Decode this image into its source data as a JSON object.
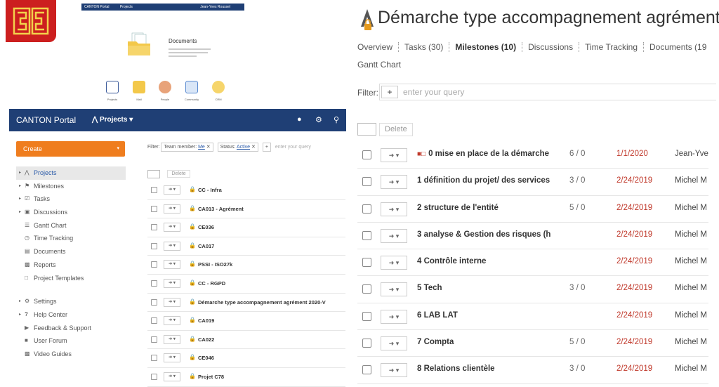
{
  "logo": {
    "name": "canton-logo"
  },
  "mini_portal": {
    "bar_title": "CANTON Portal",
    "bar_menu": "Projects",
    "bar_user": "Jean-Yves Roussel",
    "docs_title": "Documents",
    "modules": [
      "Projects",
      "Mail",
      "People",
      "Community",
      "CRM"
    ]
  },
  "left_portal": {
    "header": {
      "title": "CANTON Portal",
      "projects_label": "Projects ▾"
    },
    "create_button": "Create",
    "nav_items": [
      "Projects",
      "Milestones",
      "Tasks",
      "Discussions",
      "Gantt Chart",
      "Time Tracking",
      "Documents",
      "Reports",
      "Project Templates"
    ],
    "nav_items_secondary": [
      "Settings",
      "Help Center",
      "Feedback & Support",
      "User Forum",
      "Video Guides"
    ],
    "filter": {
      "label": "Filter:",
      "chip1_key": "Team member:",
      "chip1_val": "Me",
      "chip2_key": "Status:",
      "chip2_val": "Active",
      "placeholder": "enter your query"
    },
    "delete_label": "Delete",
    "projects": [
      "CC - Infra",
      "CA013 - Agrément",
      "CE036",
      "CA017",
      "PSSI - ISO27k",
      "CC - RGPD",
      "Démarche type accompagnement agrément 2020-V",
      "CA019",
      "CA022",
      "CE046",
      "Projet C78"
    ]
  },
  "project_view": {
    "title": "Démarche type accompagnement agrément",
    "tabs": [
      "Overview",
      "Tasks (30)",
      "Milestones (10)",
      "Discussions",
      "Time Tracking",
      "Documents (19"
    ],
    "active_tab": "Milestones (10)",
    "tab_gantt": "Gantt Chart",
    "filter_label": "Filter:",
    "filter_placeholder": "enter your query",
    "delete_label": "Delete",
    "milestones": [
      {
        "name": "0 mise en place de la démarche",
        "count": "6 / 0",
        "date": "1/1/2020",
        "owner": "Jean-Yves"
      },
      {
        "name": "1 définition du projet/ des services",
        "count": "3 / 0",
        "date": "2/24/2019",
        "owner": "Michel M"
      },
      {
        "name": "2 structure de l'entité",
        "count": "5 / 0",
        "date": "2/24/2019",
        "owner": "Michel M"
      },
      {
        "name": "3 analyse & Gestion des risques (h",
        "count": "",
        "date": "2/24/2019",
        "owner": "Michel M"
      },
      {
        "name": "4 Contrôle interne",
        "count": "",
        "date": "2/24/2019",
        "owner": "Michel M"
      },
      {
        "name": "5 Tech",
        "count": "3 / 0",
        "date": "2/24/2019",
        "owner": "Michel M"
      },
      {
        "name": "6 LAB LAT",
        "count": "",
        "date": "2/24/2019",
        "owner": "Michel M"
      },
      {
        "name": "7 Compta",
        "count": "5 / 0",
        "date": "2/24/2019",
        "owner": "Michel M"
      },
      {
        "name": "8 Relations clientèle",
        "count": "3 / 0",
        "date": "2/24/2019",
        "owner": "Michel M"
      }
    ]
  },
  "colors": {
    "brand_red": "#cc1f1f",
    "header_blue": "#1f3f75",
    "create_orange": "#ef7d1e",
    "date_red": "#c0392b"
  }
}
